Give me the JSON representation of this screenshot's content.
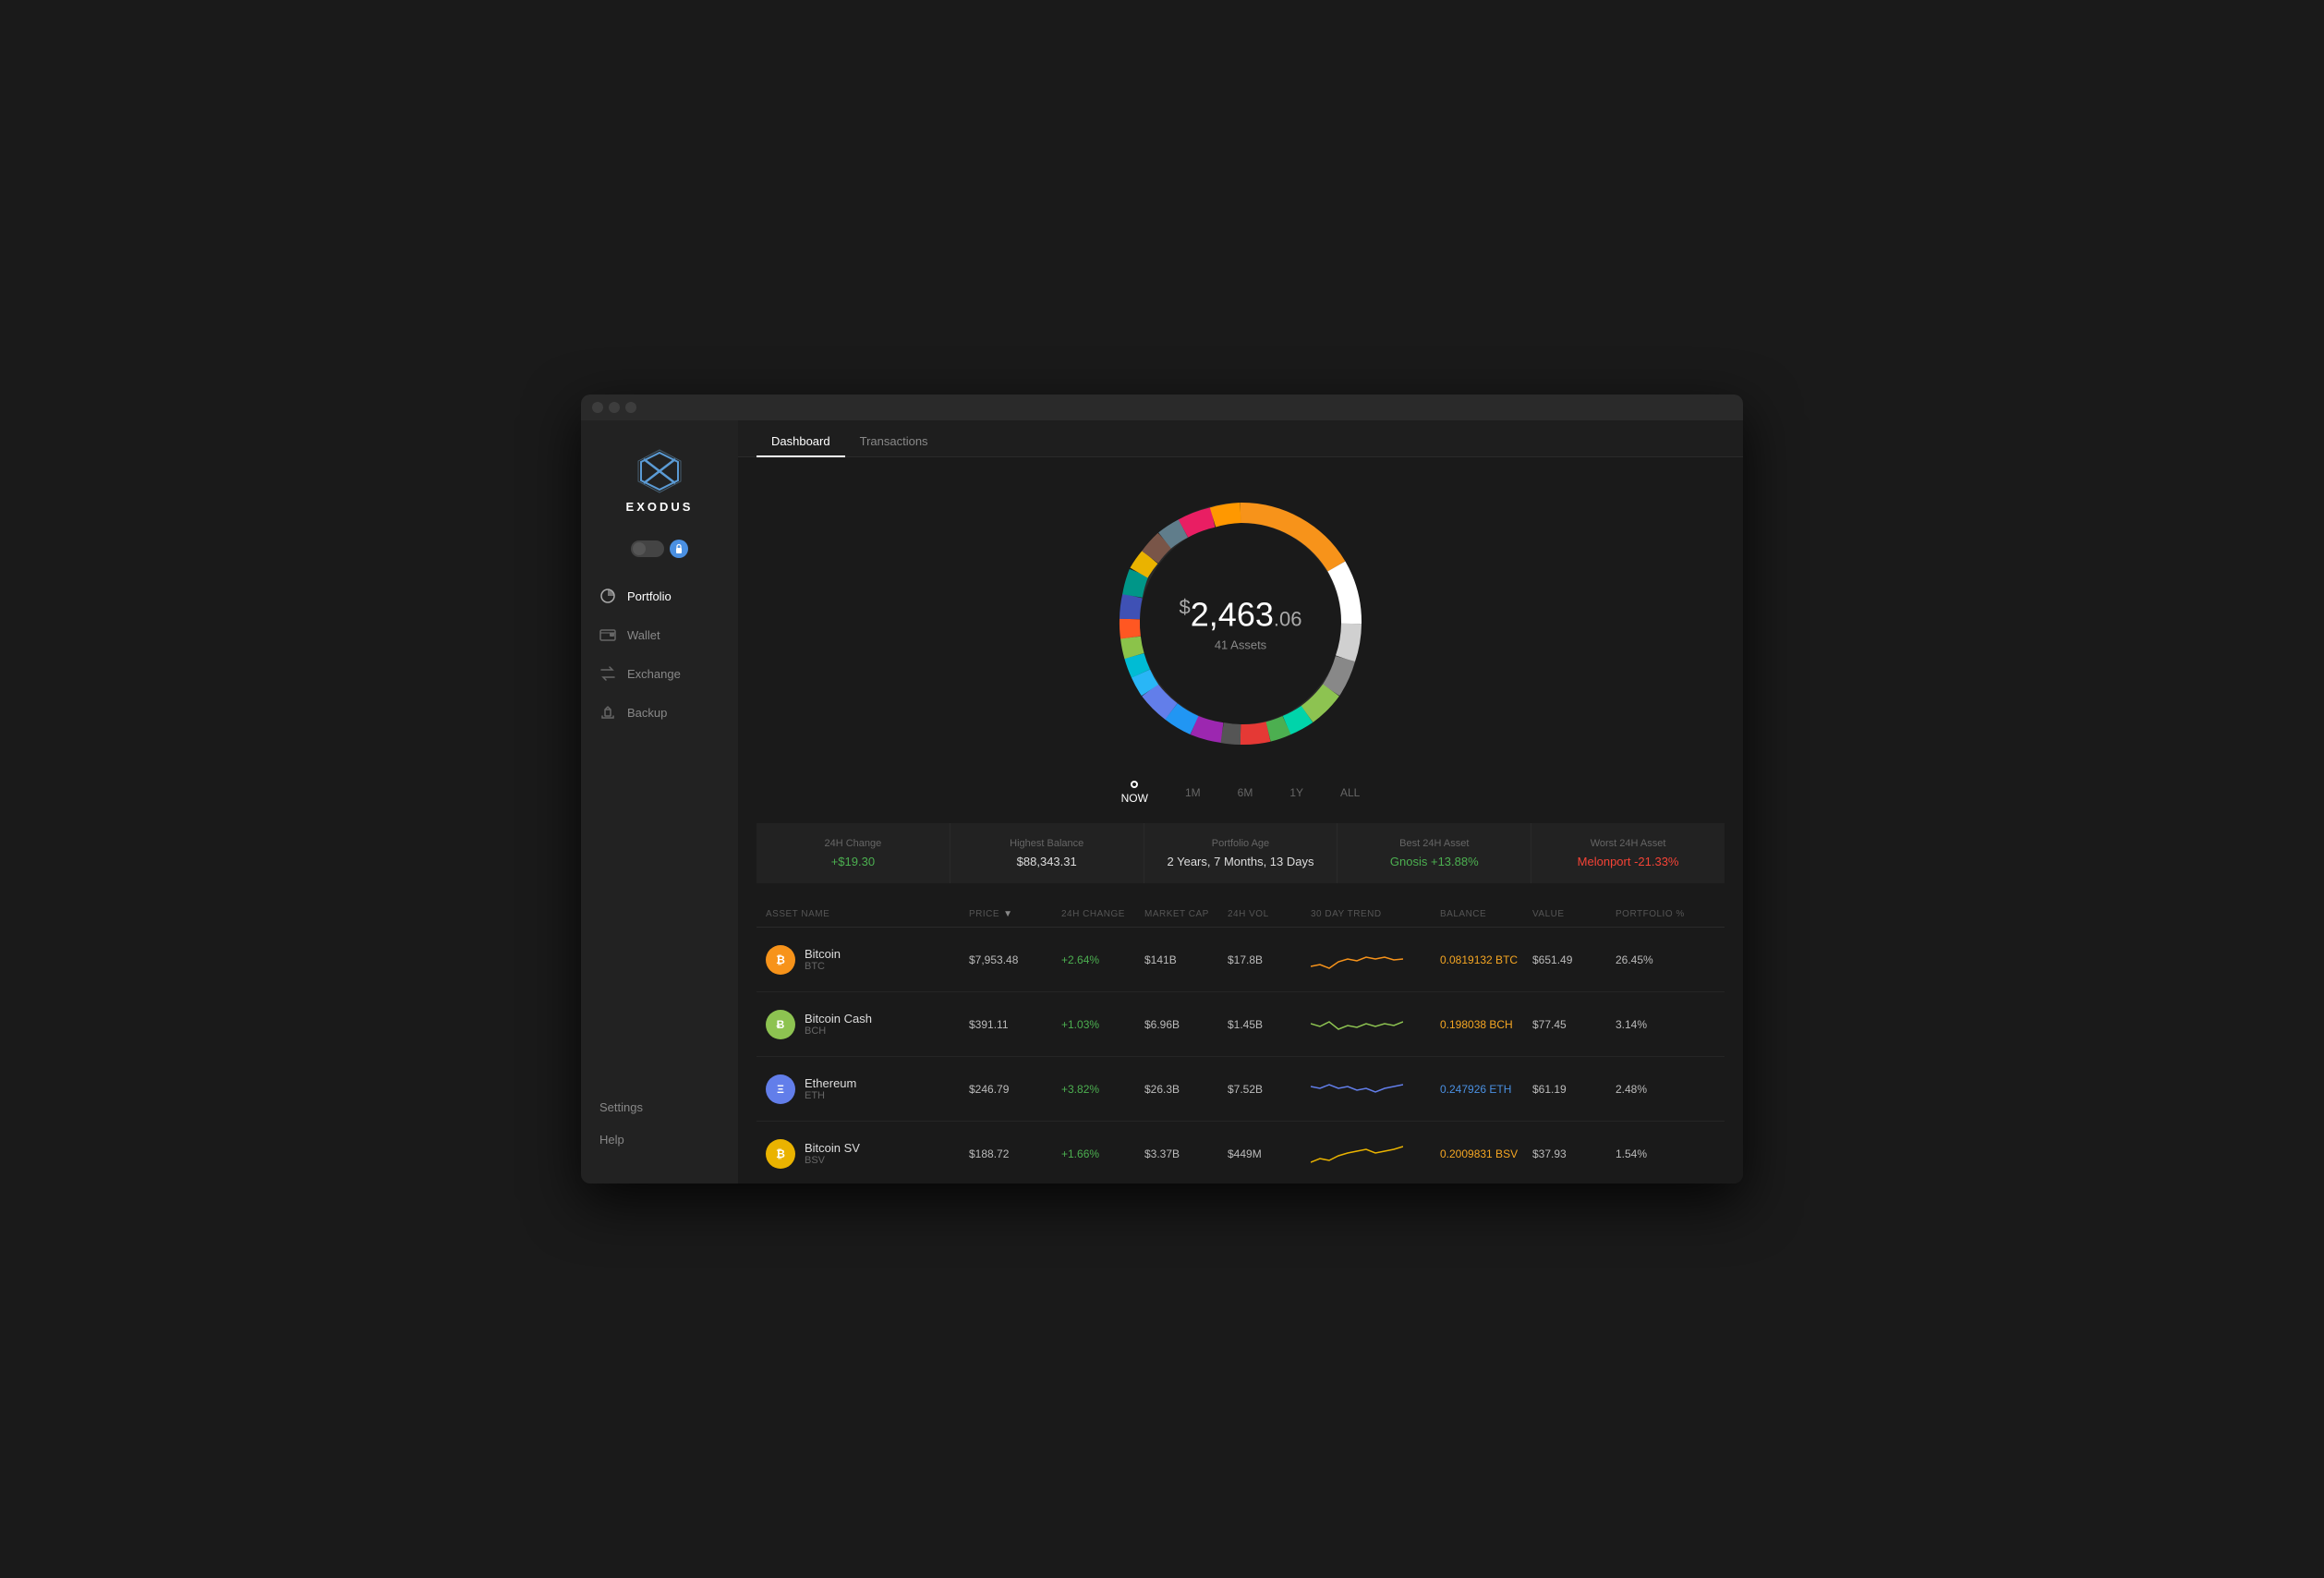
{
  "app": {
    "title": "EXODUS",
    "tabs": [
      {
        "id": "dashboard",
        "label": "Dashboard",
        "active": true
      },
      {
        "id": "transactions",
        "label": "Transactions",
        "active": false
      }
    ]
  },
  "sidebar": {
    "nav_items": [
      {
        "id": "portfolio",
        "label": "Portfolio",
        "active": true,
        "icon": "portfolio-icon"
      },
      {
        "id": "wallet",
        "label": "Wallet",
        "active": false,
        "icon": "wallet-icon"
      },
      {
        "id": "exchange",
        "label": "Exchange",
        "active": false,
        "icon": "exchange-icon"
      },
      {
        "id": "backup",
        "label": "Backup",
        "active": false,
        "icon": "backup-icon"
      }
    ],
    "bottom_items": [
      {
        "id": "settings",
        "label": "Settings"
      },
      {
        "id": "help",
        "label": "Help"
      }
    ]
  },
  "portfolio": {
    "total_value": "2,463",
    "total_cents": ".06",
    "dollar_sign": "$",
    "assets_count": "41 Assets",
    "time_options": [
      {
        "id": "now",
        "label": "NOW",
        "active": true
      },
      {
        "id": "1m",
        "label": "1M",
        "active": false
      },
      {
        "id": "6m",
        "label": "6M",
        "active": false
      },
      {
        "id": "1y",
        "label": "1Y",
        "active": false
      },
      {
        "id": "all",
        "label": "ALL",
        "active": false
      }
    ]
  },
  "stats": [
    {
      "label": "24H Change",
      "value": "+$19.30",
      "positive": true
    },
    {
      "label": "Highest Balance",
      "value": "$88,343.31",
      "positive": false
    },
    {
      "label": "Portfolio Age",
      "value": "2 Years, 7 Months, 13 Days",
      "positive": false
    },
    {
      "label": "Best 24H Asset",
      "value": "Gnosis +13.88%",
      "positive": true
    },
    {
      "label": "Worst 24H Asset",
      "value": "Melonport -21.33%",
      "positive": false
    }
  ],
  "table": {
    "headers": [
      {
        "id": "name",
        "label": "ASSET NAME"
      },
      {
        "id": "price",
        "label": "PRICE",
        "sortable": true
      },
      {
        "id": "change",
        "label": "24H CHANGE"
      },
      {
        "id": "marketcap",
        "label": "MARKET CAP"
      },
      {
        "id": "vol",
        "label": "24H VOL"
      },
      {
        "id": "trend",
        "label": "30 DAY TREND"
      },
      {
        "id": "balance",
        "label": "BALANCE"
      },
      {
        "id": "value",
        "label": "VALUE"
      },
      {
        "id": "portfolio",
        "label": "PORTFOLIO %"
      }
    ],
    "rows": [
      {
        "name": "Bitcoin",
        "ticker": "BTC",
        "icon_color": "#f7931a",
        "icon_text": "₿",
        "price": "$7,953.48",
        "change": "+2.64%",
        "change_positive": true,
        "marketcap": "$141B",
        "vol": "$17.8B",
        "balance": "0.0819132 BTC",
        "balance_accent": true,
        "value": "$651.49",
        "portfolio": "26.45%",
        "sparkline_color": "#f7931a"
      },
      {
        "name": "Bitcoin Cash",
        "ticker": "BCH",
        "icon_color": "#8dc351",
        "icon_text": "Ƀ",
        "price": "$391.11",
        "change": "+1.03%",
        "change_positive": true,
        "marketcap": "$6.96B",
        "vol": "$1.45B",
        "balance": "0.198038 BCH",
        "balance_accent": true,
        "value": "$77.45",
        "portfolio": "3.14%",
        "sparkline_color": "#8dc351"
      },
      {
        "name": "Ethereum",
        "ticker": "ETH",
        "icon_color": "#627eea",
        "icon_text": "Ξ",
        "price": "$246.79",
        "change": "+3.82%",
        "change_positive": true,
        "marketcap": "$26.3B",
        "vol": "$7.52B",
        "balance": "0.247926 ETH",
        "balance_accent": true,
        "value": "$61.19",
        "portfolio": "2.48%",
        "sparkline_color": "#627eea"
      },
      {
        "name": "Bitcoin SV",
        "ticker": "BSV",
        "icon_color": "#eab300",
        "icon_text": "₿",
        "price": "$188.72",
        "change": "+1.66%",
        "change_positive": true,
        "marketcap": "$3.37B",
        "vol": "$449M",
        "balance": "0.2009831 BSV",
        "balance_accent": true,
        "value": "$37.93",
        "portfolio": "1.54%",
        "sparkline_color": "#eab300"
      }
    ]
  },
  "donut": {
    "segments": [
      {
        "color": "#f7931a",
        "pct": 26
      },
      {
        "color": "#ffffff",
        "pct": 15
      },
      {
        "color": "#8dc351",
        "pct": 8
      },
      {
        "color": "#627eea",
        "pct": 6
      },
      {
        "color": "#e8e8e8",
        "pct": 5
      },
      {
        "color": "#aaaaaa",
        "pct": 4
      },
      {
        "color": "#00d4aa",
        "pct": 4
      },
      {
        "color": "#4caf50",
        "pct": 3
      },
      {
        "color": "#ff6b35",
        "pct": 3
      },
      {
        "color": "#e91e63",
        "pct": 3
      },
      {
        "color": "#9c27b0",
        "pct": 3
      },
      {
        "color": "#2196f3",
        "pct": 3
      },
      {
        "color": "#ff9800",
        "pct": 2
      },
      {
        "color": "#00bcd4",
        "pct": 2
      },
      {
        "color": "#8bc34a",
        "pct": 2
      },
      {
        "color": "#ff5722",
        "pct": 2
      },
      {
        "color": "#795548",
        "pct": 2
      },
      {
        "color": "#607d8b",
        "pct": 2
      },
      {
        "color": "#3f51b5",
        "pct": 2
      },
      {
        "color": "#009688",
        "pct": 1
      }
    ]
  }
}
